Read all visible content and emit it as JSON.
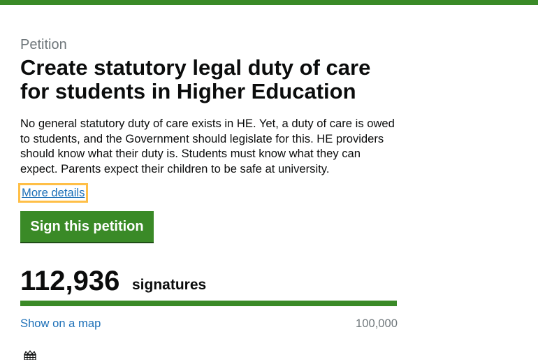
{
  "colors": {
    "brand_green": "#3a8a27",
    "link_blue": "#1d70b8",
    "focus_yellow": "#ffbf47",
    "secondary_text": "#6f777b"
  },
  "petition": {
    "caption": "Petition",
    "title": "Create statutory legal duty of care for students in Higher Education",
    "summary": "No general statutory duty of care exists in HE. Yet, a duty of care is owed to students, and the Government should legislate for this. HE providers should know what their duty is. Students must know what they can expect. Parents expect their children to be safe at university.",
    "more_details_label": "More details",
    "sign_button_label": "Sign this petition"
  },
  "signatures": {
    "count_text": "112,936",
    "label": "signatures",
    "progress_fraction": 1.0,
    "map_link_label": "Show on a map",
    "target_text": "100,000"
  },
  "footer": {
    "crest_icon": "crown-portcullis-icon"
  }
}
